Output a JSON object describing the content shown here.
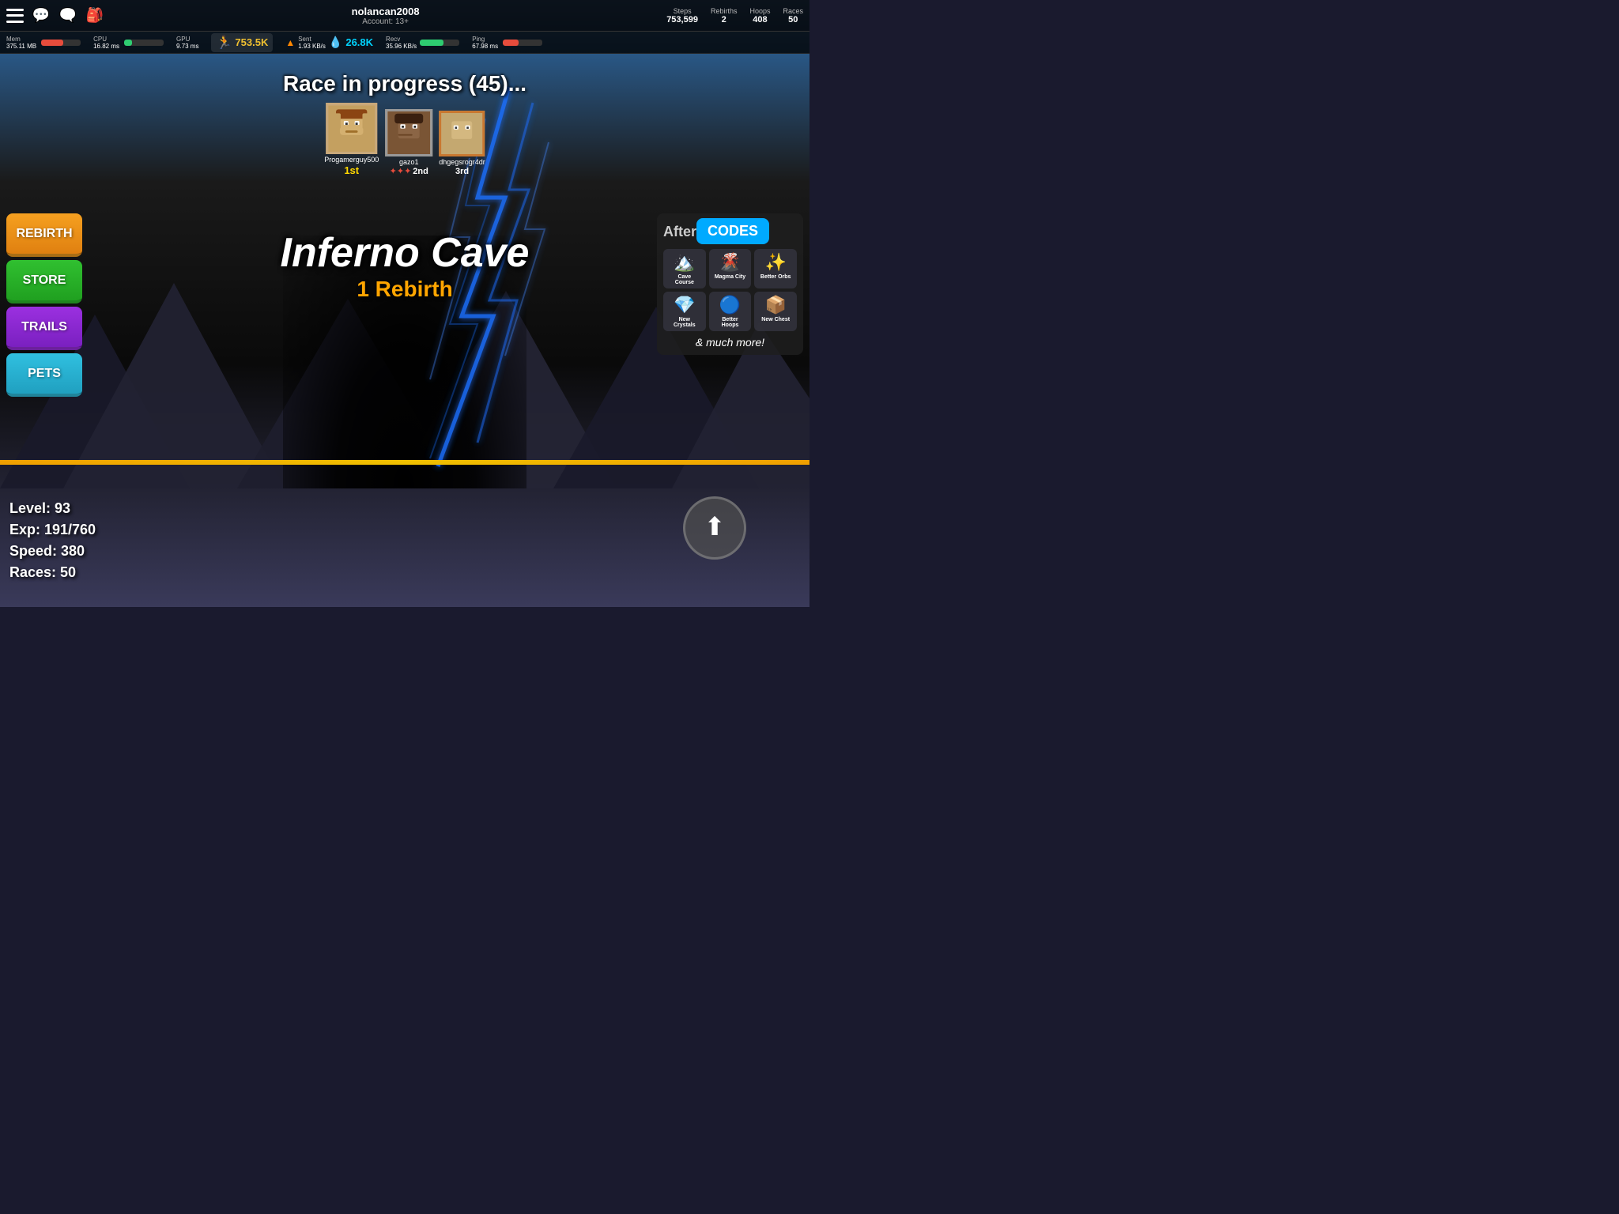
{
  "topbar": {
    "player_name": "nolancan2008",
    "account": "Account: 13+",
    "stats": {
      "steps_label": "Steps",
      "steps_value": "753,599",
      "rebirths_label": "Rebirths",
      "rebirths_value": "2",
      "hoops_label": "Hoops",
      "hoops_value": "408",
      "races_label": "Races",
      "races_value": "50"
    }
  },
  "perf": {
    "mem_label": "Mem",
    "mem_value": "375.11 MB",
    "cpu_label": "CPU",
    "cpu_value": "16.82 ms",
    "gpu_label": "GPU",
    "gpu_value": "9.73 ms",
    "speed_value": "753.5K",
    "sent_label": "Sent",
    "sent_value": "1.93 KB/s",
    "sent_highlight": "26.8K",
    "recv_label": "Recv",
    "recv_value": "35.96 KB/s",
    "ping_label": "Ping",
    "ping_value": "67.98 ms"
  },
  "race": {
    "title": "Race in progress (45)...",
    "players": [
      {
        "rank": "1st",
        "name": "Progamerguy500",
        "rank_class": "rank-1st"
      },
      {
        "rank": "2nd",
        "name": "gazo1",
        "rank_class": "rank-2nd"
      },
      {
        "rank": "3rd",
        "name": "dhgegsrogr4dr",
        "rank_class": "rank-3rd"
      }
    ]
  },
  "location": {
    "name": "Inferno Cave",
    "requirement": "1 Rebirth"
  },
  "buttons": {
    "rebirth": "REBIRTH",
    "store": "STORE",
    "trails": "TRAILS",
    "pets": "PETS"
  },
  "right_panel": {
    "after_text": "After ",
    "codes_label": "CODES",
    "updates": [
      {
        "label": "Cave\nCourse",
        "icon": "🏔️"
      },
      {
        "label": "Magma City",
        "icon": "🌋"
      },
      {
        "label": "Better Orbs",
        "icon": "✨"
      },
      {
        "label": "New\nCrystals",
        "icon": "💎"
      },
      {
        "label": "Better\nHoops",
        "icon": "🔵"
      },
      {
        "label": "New Chest",
        "icon": "📦"
      }
    ],
    "much_more": "& much more!"
  },
  "player_stats": {
    "level": "Level: 93",
    "exp": "Exp: 191/760",
    "speed": "Speed: 380",
    "races": "Races: 50"
  },
  "up_button": {
    "label": "↑"
  }
}
